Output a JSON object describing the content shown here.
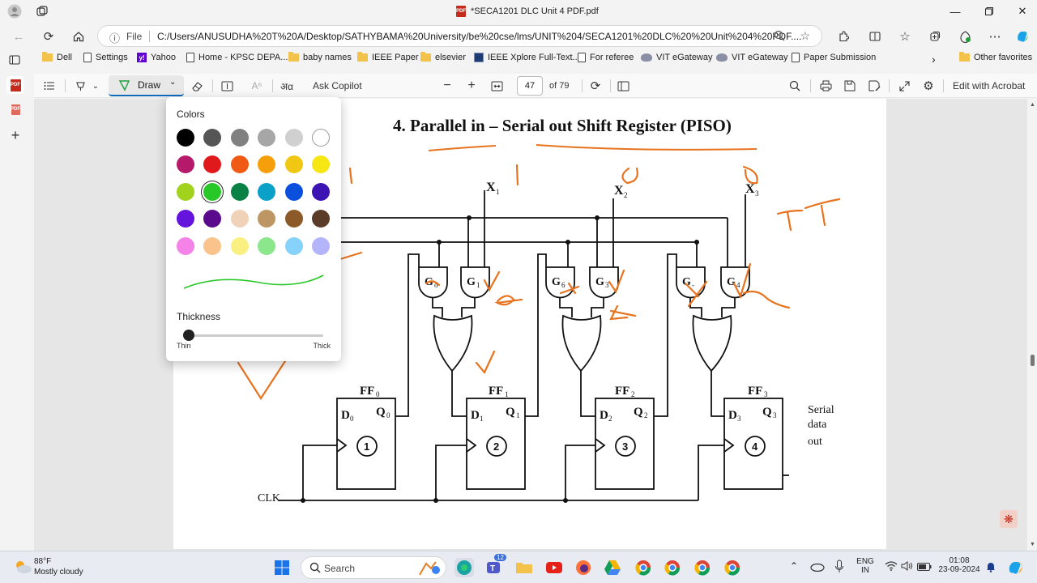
{
  "window": {
    "title": "*SECA1201 DLC Unit 4 PDF.pdf"
  },
  "address": {
    "prefix": "File",
    "url": "C:/Users/ANUSUDHA%20T%20A/Desktop/SATHYBAMA%20University/be%20cse/lms/UNIT%204/SECA1201%20DLC%20%20Unit%204%20PDF...."
  },
  "favorites": [
    {
      "label": "Dell",
      "icon": "folder-icon"
    },
    {
      "label": "Settings",
      "icon": "page-icon"
    },
    {
      "label": "Yahoo",
      "icon": "yahoo-icon"
    },
    {
      "label": "Home - KPSC DEPA...",
      "icon": "page-icon"
    },
    {
      "label": "baby names",
      "icon": "folder-icon"
    },
    {
      "label": "IEEE Paper",
      "icon": "folder-icon"
    },
    {
      "label": "elsevier",
      "icon": "folder-icon"
    },
    {
      "label": "IEEE Xplore Full-Text...",
      "icon": "ieee-icon"
    },
    {
      "label": "For referee",
      "icon": "page-icon"
    },
    {
      "label": "VIT eGateway",
      "icon": "vit-icon"
    },
    {
      "label": "VIT eGateway",
      "icon": "vit-icon"
    },
    {
      "label": "Paper Submission",
      "icon": "page-icon"
    }
  ],
  "favorites_other": "Other favorites",
  "pdf_toolbar": {
    "draw_label": "Draw",
    "copilot_label": "Ask Copilot",
    "page_current": "47",
    "page_total": "of 79",
    "acrobat_label": "Edit with Acrobat"
  },
  "draw_popup": {
    "colors_heading": "Colors",
    "colors": [
      [
        "#000000",
        "#555555",
        "#808080",
        "#a6a6a6",
        "#d0d0d0",
        "#ffffff"
      ],
      [
        "#b4196a",
        "#e0191c",
        "#f05a14",
        "#f5a00a",
        "#f0c814",
        "#f5e614"
      ],
      [
        "#a0d21e",
        "#28c828",
        "#0a8246",
        "#0aa0c8",
        "#0a50dc",
        "#3c14b4"
      ],
      [
        "#6414dc",
        "#5a0a8c",
        "#f0d2b9",
        "#be9664",
        "#8c5a28",
        "#5a3c28"
      ],
      [
        "#f582e6",
        "#fac38c",
        "#faf082",
        "#8ce68c",
        "#87d2fa",
        "#b4b4fa"
      ]
    ],
    "selected_color": "#28c828",
    "thickness_heading": "Thickness",
    "thickness_value": 0,
    "thin_label": "Thin",
    "thick_label": "Thick"
  },
  "document": {
    "title": "4. Parallel in – Serial out Shift Register (PISO)",
    "inputs": [
      "X",
      "X",
      "X"
    ],
    "input_subs": [
      "1",
      "2",
      "3"
    ],
    "gates": [
      "G",
      "G",
      "G",
      "G",
      "G",
      "G"
    ],
    "gate_subs": [
      "o",
      "1",
      "6",
      "3",
      "-",
      "4"
    ],
    "flipflops": [
      {
        "name": "FF",
        "sub": "0",
        "d": "D",
        "dsub": "0",
        "q": "Q",
        "qsub": "0",
        "num": "1"
      },
      {
        "name": "FF",
        "sub": "1",
        "d": "D",
        "dsub": "1",
        "q": "Q",
        "qsub": "1",
        "num": "2"
      },
      {
        "name": "FF",
        "sub": "2",
        "d": "D",
        "dsub": "2",
        "q": "Q",
        "qsub": "2",
        "num": "3"
      },
      {
        "name": "FF",
        "sub": "3",
        "d": "D",
        "dsub": "3",
        "q": "Q",
        "qsub": "3",
        "num": "4"
      }
    ],
    "clk_label": "CLK",
    "output_label": [
      "Serial",
      "data",
      "out"
    ]
  },
  "taskbar": {
    "weather_temp": "88°F",
    "weather_desc": "Mostly cloudy",
    "search_placeholder": "Search",
    "lang_1": "ENG",
    "lang_2": "IN",
    "time": "01:08",
    "date": "23-09-2024",
    "teams_badge": "12"
  }
}
